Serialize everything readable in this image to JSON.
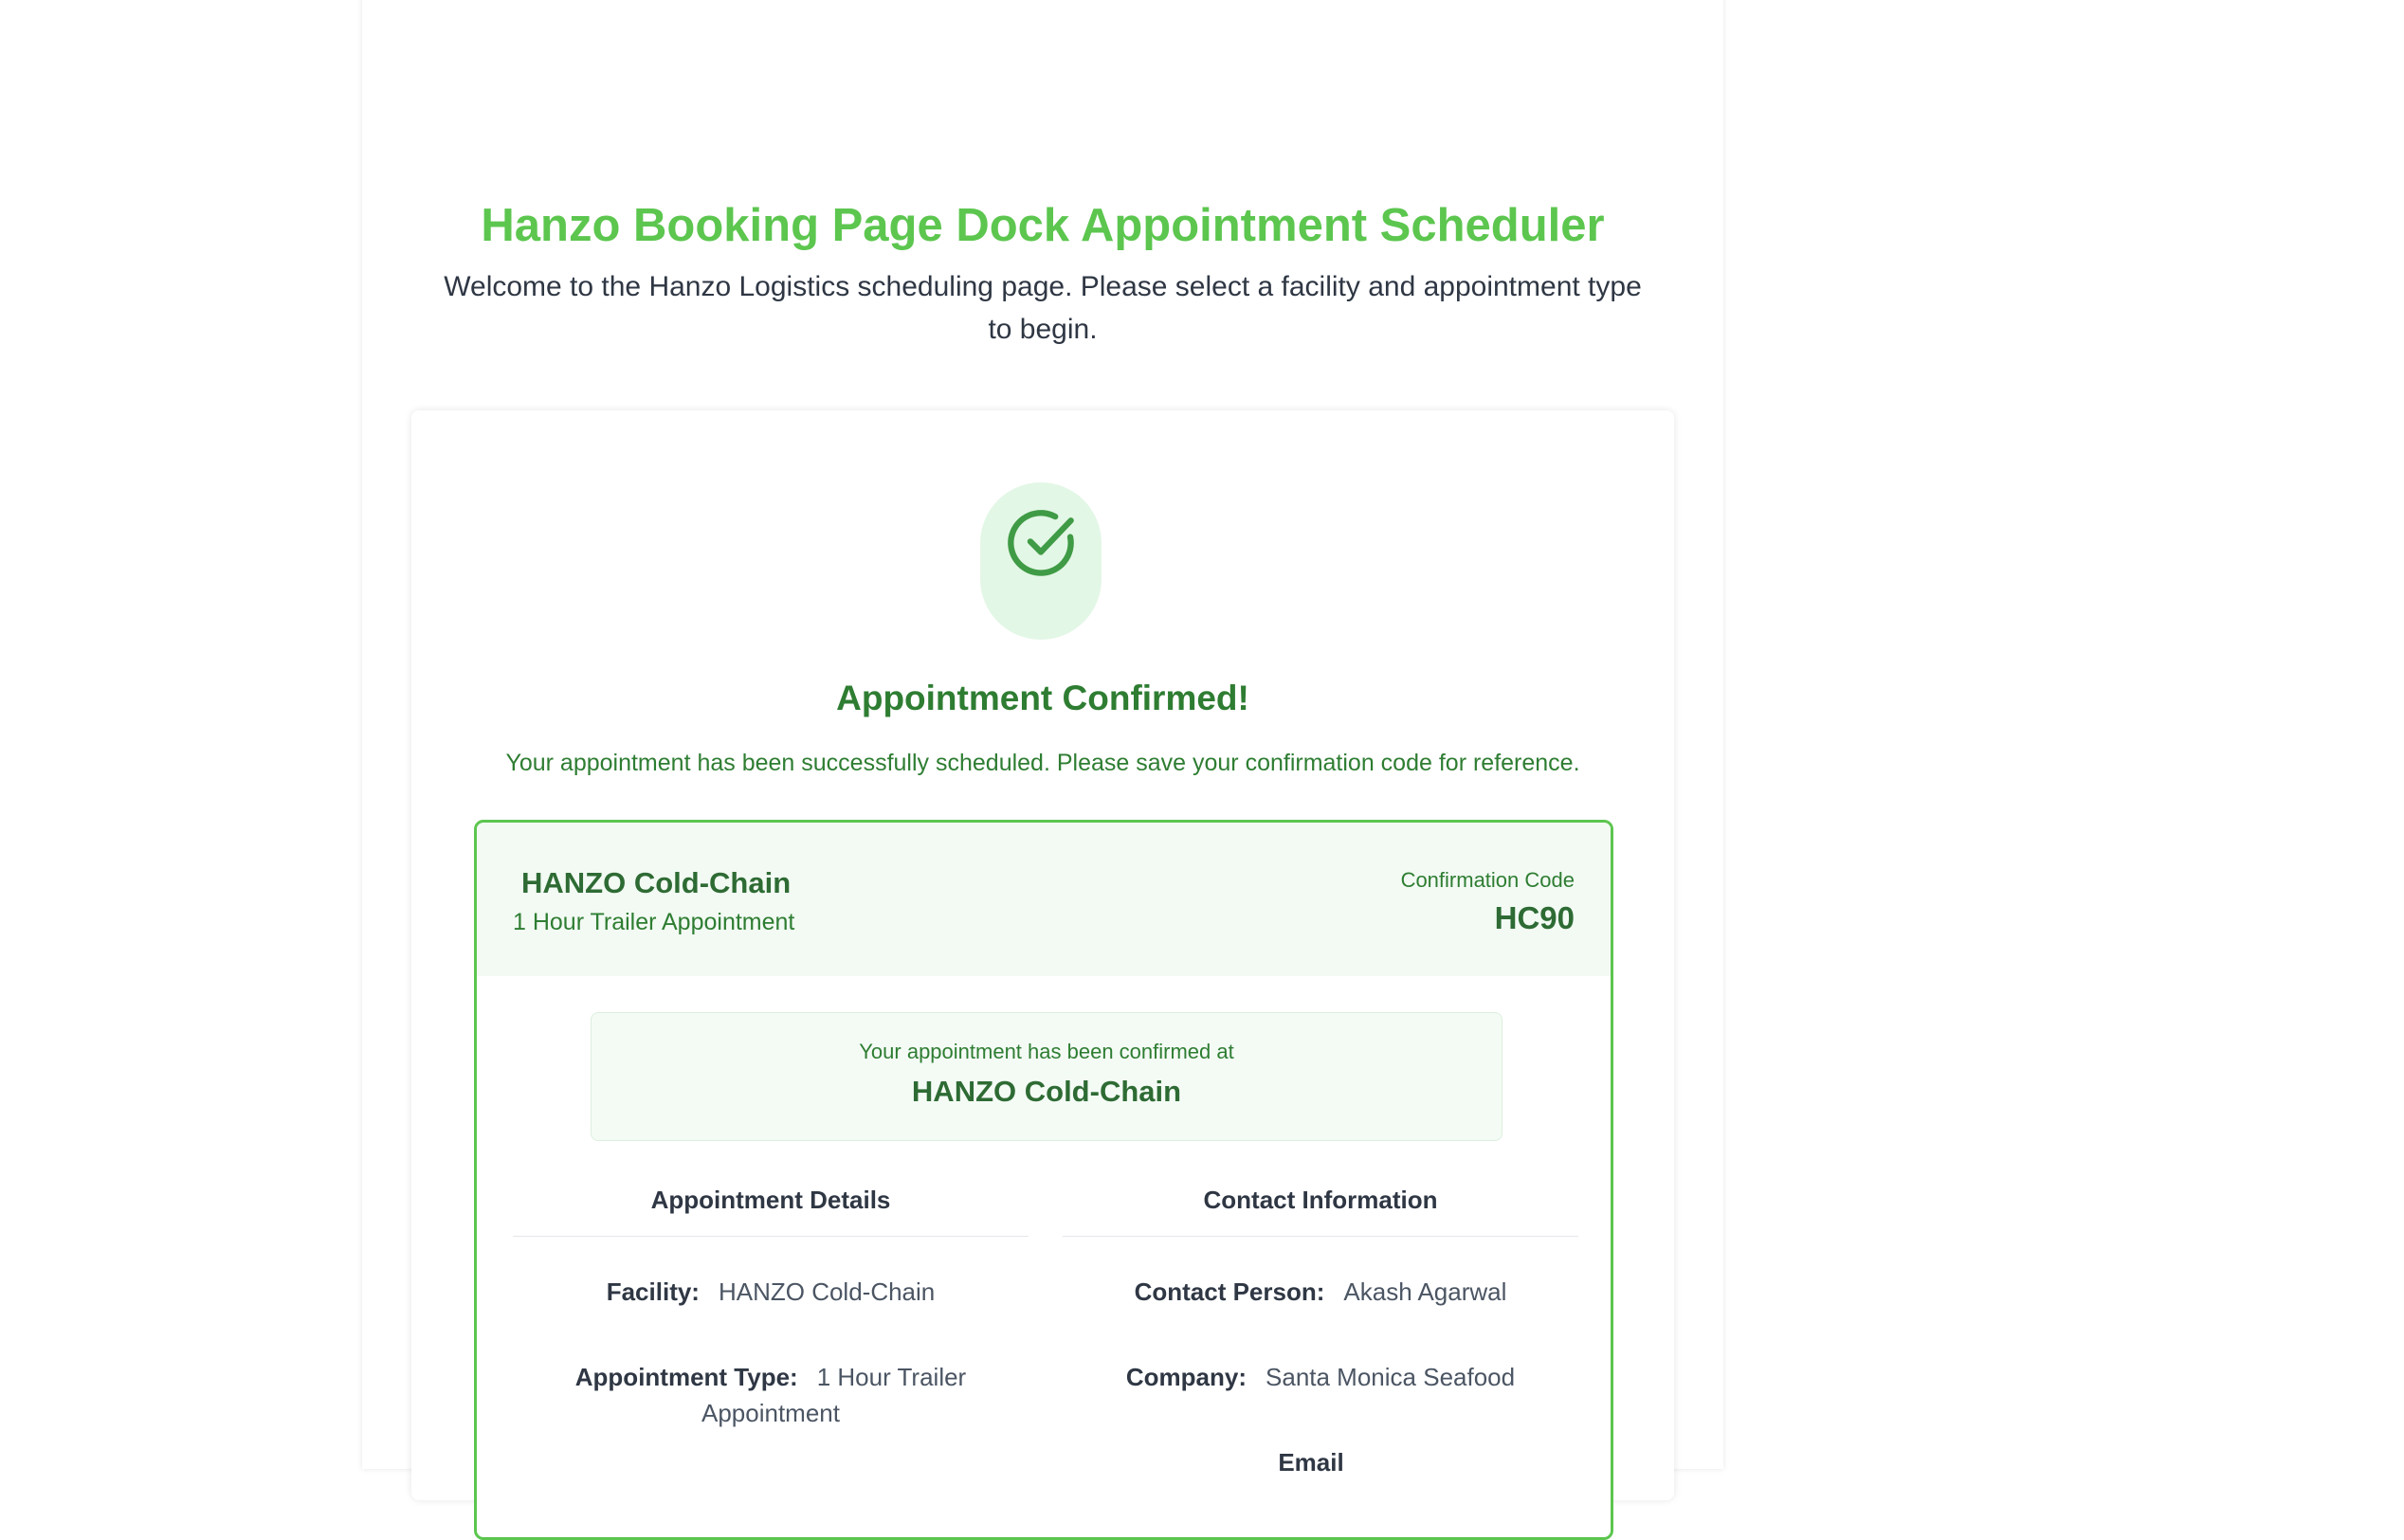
{
  "page": {
    "title": "Hanzo Booking Page Dock Appointment Scheduler",
    "subtitle": "Welcome to the Hanzo Logistics scheduling page. Please select a facility and appointment type to begin."
  },
  "confirmation": {
    "icon": "check-circle-icon",
    "heading": "Appointment Confirmed!",
    "message": "Your appointment has been successfully scheduled. Please save your confirmation code for reference."
  },
  "details": {
    "facility_name": "HANZO Cold-Chain",
    "appointment_type": "1 Hour Trailer Appointment",
    "code_label": "Confirmation Code",
    "code_value": "HC90",
    "confirmed_at_label": "Your appointment has been confirmed at",
    "confirmed_at_name": "HANZO Cold-Chain"
  },
  "appointment_details": {
    "heading": "Appointment Details",
    "rows": [
      {
        "label": "Facility:",
        "value": "HANZO Cold-Chain"
      },
      {
        "label": "Appointment Type:",
        "value": "1 Hour Trailer Appointment"
      }
    ]
  },
  "contact_information": {
    "heading": "Contact Information",
    "rows": [
      {
        "label": "Contact Person:",
        "value": "Akash Agarwal"
      },
      {
        "label": "Company:",
        "value": "Santa Monica Seafood"
      },
      {
        "label": "Email",
        "value": ""
      }
    ]
  },
  "colors": {
    "title_green": "#5cc64f",
    "success_green": "#2e7d32",
    "badge_bg": "#e3f7e6",
    "card_border": "#5cc64f"
  }
}
